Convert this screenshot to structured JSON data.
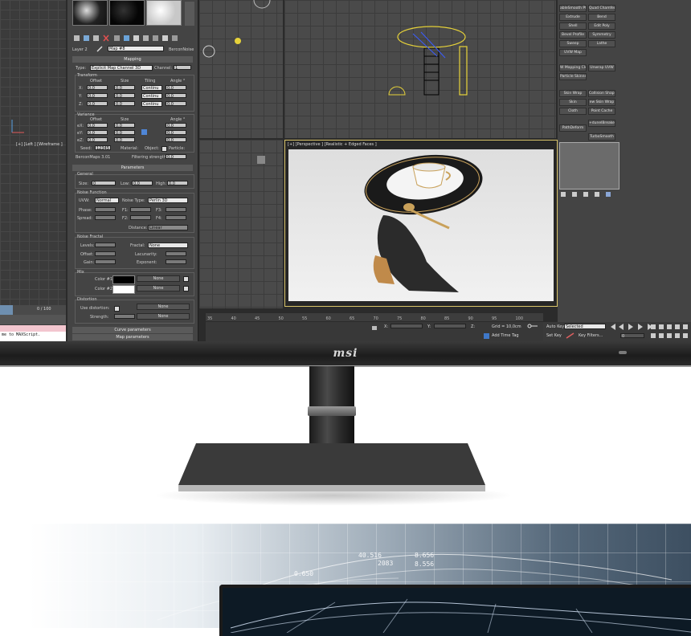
{
  "left_viewport": {
    "label": "[+] [Left ] [Wireframe ]",
    "frame_counter": "0 / 100",
    "maxscript_text": "me to MAXScript."
  },
  "material_editor": {
    "layer_label": "Layer 2",
    "map_name": "Map #8",
    "map_type": "BerconNoise",
    "mapping": {
      "header": "Mapping",
      "type_label": "Type:",
      "type_value": "Explicit Map Channel 3D",
      "channel_label": "Channel:",
      "channel_value": "1",
      "transform_label": "Transform",
      "col_offset": "Offset",
      "col_size": "Size",
      "col_tiling": "Tiling",
      "col_angle": "Angle °",
      "rows": [
        {
          "axis": "X:",
          "offset": "0,0",
          "size": "0,0",
          "tiling": "Continu",
          "angle": "0,0"
        },
        {
          "axis": "Y:",
          "offset": "0,0",
          "size": "0,0",
          "tiling": "Continu",
          "angle": "0,0"
        },
        {
          "axis": "Z:",
          "offset": "0,0",
          "size": "0,0",
          "tiling": "Continu",
          "angle": "0,0"
        }
      ],
      "variance_label": "Variance",
      "variance_rows": [
        {
          "axis": "eX:",
          "offset": "0,0",
          "size": "0,0",
          "angle": "0,0"
        },
        {
          "axis": "eY:",
          "offset": "0,0",
          "size": "0,0",
          "angle": "0,0"
        },
        {
          "axis": "eZ:",
          "offset": "0,0",
          "size": "0,0",
          "angle": "0,0"
        }
      ],
      "seed_label": "Seed:",
      "seed_value": "12345",
      "material_label": "Material:",
      "object_label": "Object:",
      "particle_label": "Particle:",
      "version": "BerconMaps 3.01",
      "filtering_label": "Filtering strength:",
      "filtering_value": "0,0"
    },
    "parameters": {
      "header": "Parameters",
      "general_label": "General",
      "size_label": "Size:",
      "size_value": "0",
      "low_label": "Low:",
      "low_value": "0,0",
      "high_label": "High:",
      "high_value": "0,0",
      "noise_function_label": "Noise Function",
      "uvw_label": "UVW:",
      "uvw_value": "Normal",
      "noise_type_label": "Noise Type:",
      "noise_type_value": "Perlin 3D",
      "phase_label": "Phase:",
      "f1_label": "F1:",
      "f2_label": "F2:",
      "f3_label": "F3:",
      "f4_label": "F4:",
      "spread_label": "Spread:",
      "distance_label": "Distance:",
      "distance_value": "Linear",
      "noise_fractal_label": "Noise Fractal",
      "levels_label": "Levels:",
      "fractal_label": "Fractal:",
      "fractal_value": "None",
      "offset_label": "Offset:",
      "lacunarity_label": "Lacunarity:",
      "gain_label": "Gain:",
      "exponent_label": "Exponent:",
      "mix_label": "Mix",
      "color1_label": "Color #1:",
      "color2_label": "Color #2:",
      "none_label": "None",
      "distortion_label": "Distortion",
      "use_distortion_label": "Use distortion:",
      "strength_label": "Strength:"
    },
    "rollouts": [
      "Curve parameters",
      "Map parameters"
    ]
  },
  "perspective_viewport": {
    "label": "[+] [Perspective ] [Realistic + Edged Faces ]"
  },
  "timeline": {
    "ticks": [
      "35",
      "40",
      "45",
      "50",
      "55",
      "60",
      "65",
      "70",
      "75",
      "80",
      "85",
      "90",
      "95",
      "100"
    ]
  },
  "status": {
    "x_label": "X:",
    "y_label": "Y:",
    "z_label": "Z:",
    "grid": "Grid = 10,0cm",
    "add_time_tag": "Add Time Tag"
  },
  "command_panel": {
    "buttons_col1": [
      "ableSmooth Pt",
      "Extrude",
      "Shell",
      "Bevel Profile",
      "Sweep",
      "UVW Map",
      "W Mapping Cle",
      "Particle Skinner",
      "Skin Wrap",
      "Skin",
      "Cloth",
      "PathDeform"
    ],
    "buttons_col2": [
      "Quad Chamfer",
      "Bend",
      "Edit Poly",
      "Symmetry",
      "Lathe",
      "",
      "Unwrap UVW",
      "",
      "Collision Shape",
      "ew Skin Wrap",
      "Point Cache",
      "",
      "TurboSmooth",
      "+dunelBreaker"
    ]
  },
  "animation": {
    "auto_key": "Auto Key",
    "selected": "Selected",
    "set_key": "Set Key",
    "key_filters": "Key Filters...",
    "frame": "0"
  },
  "monitor": {
    "brand": "msi"
  },
  "hero_overlay": [
    "40.516",
    "8.656",
    "2083",
    "8.556",
    "0.650"
  ],
  "colors": {
    "accent_selection": "#d9c46a",
    "sphere_yellow": "#e6d23a",
    "viewport_grid": "#4a4a4a"
  }
}
